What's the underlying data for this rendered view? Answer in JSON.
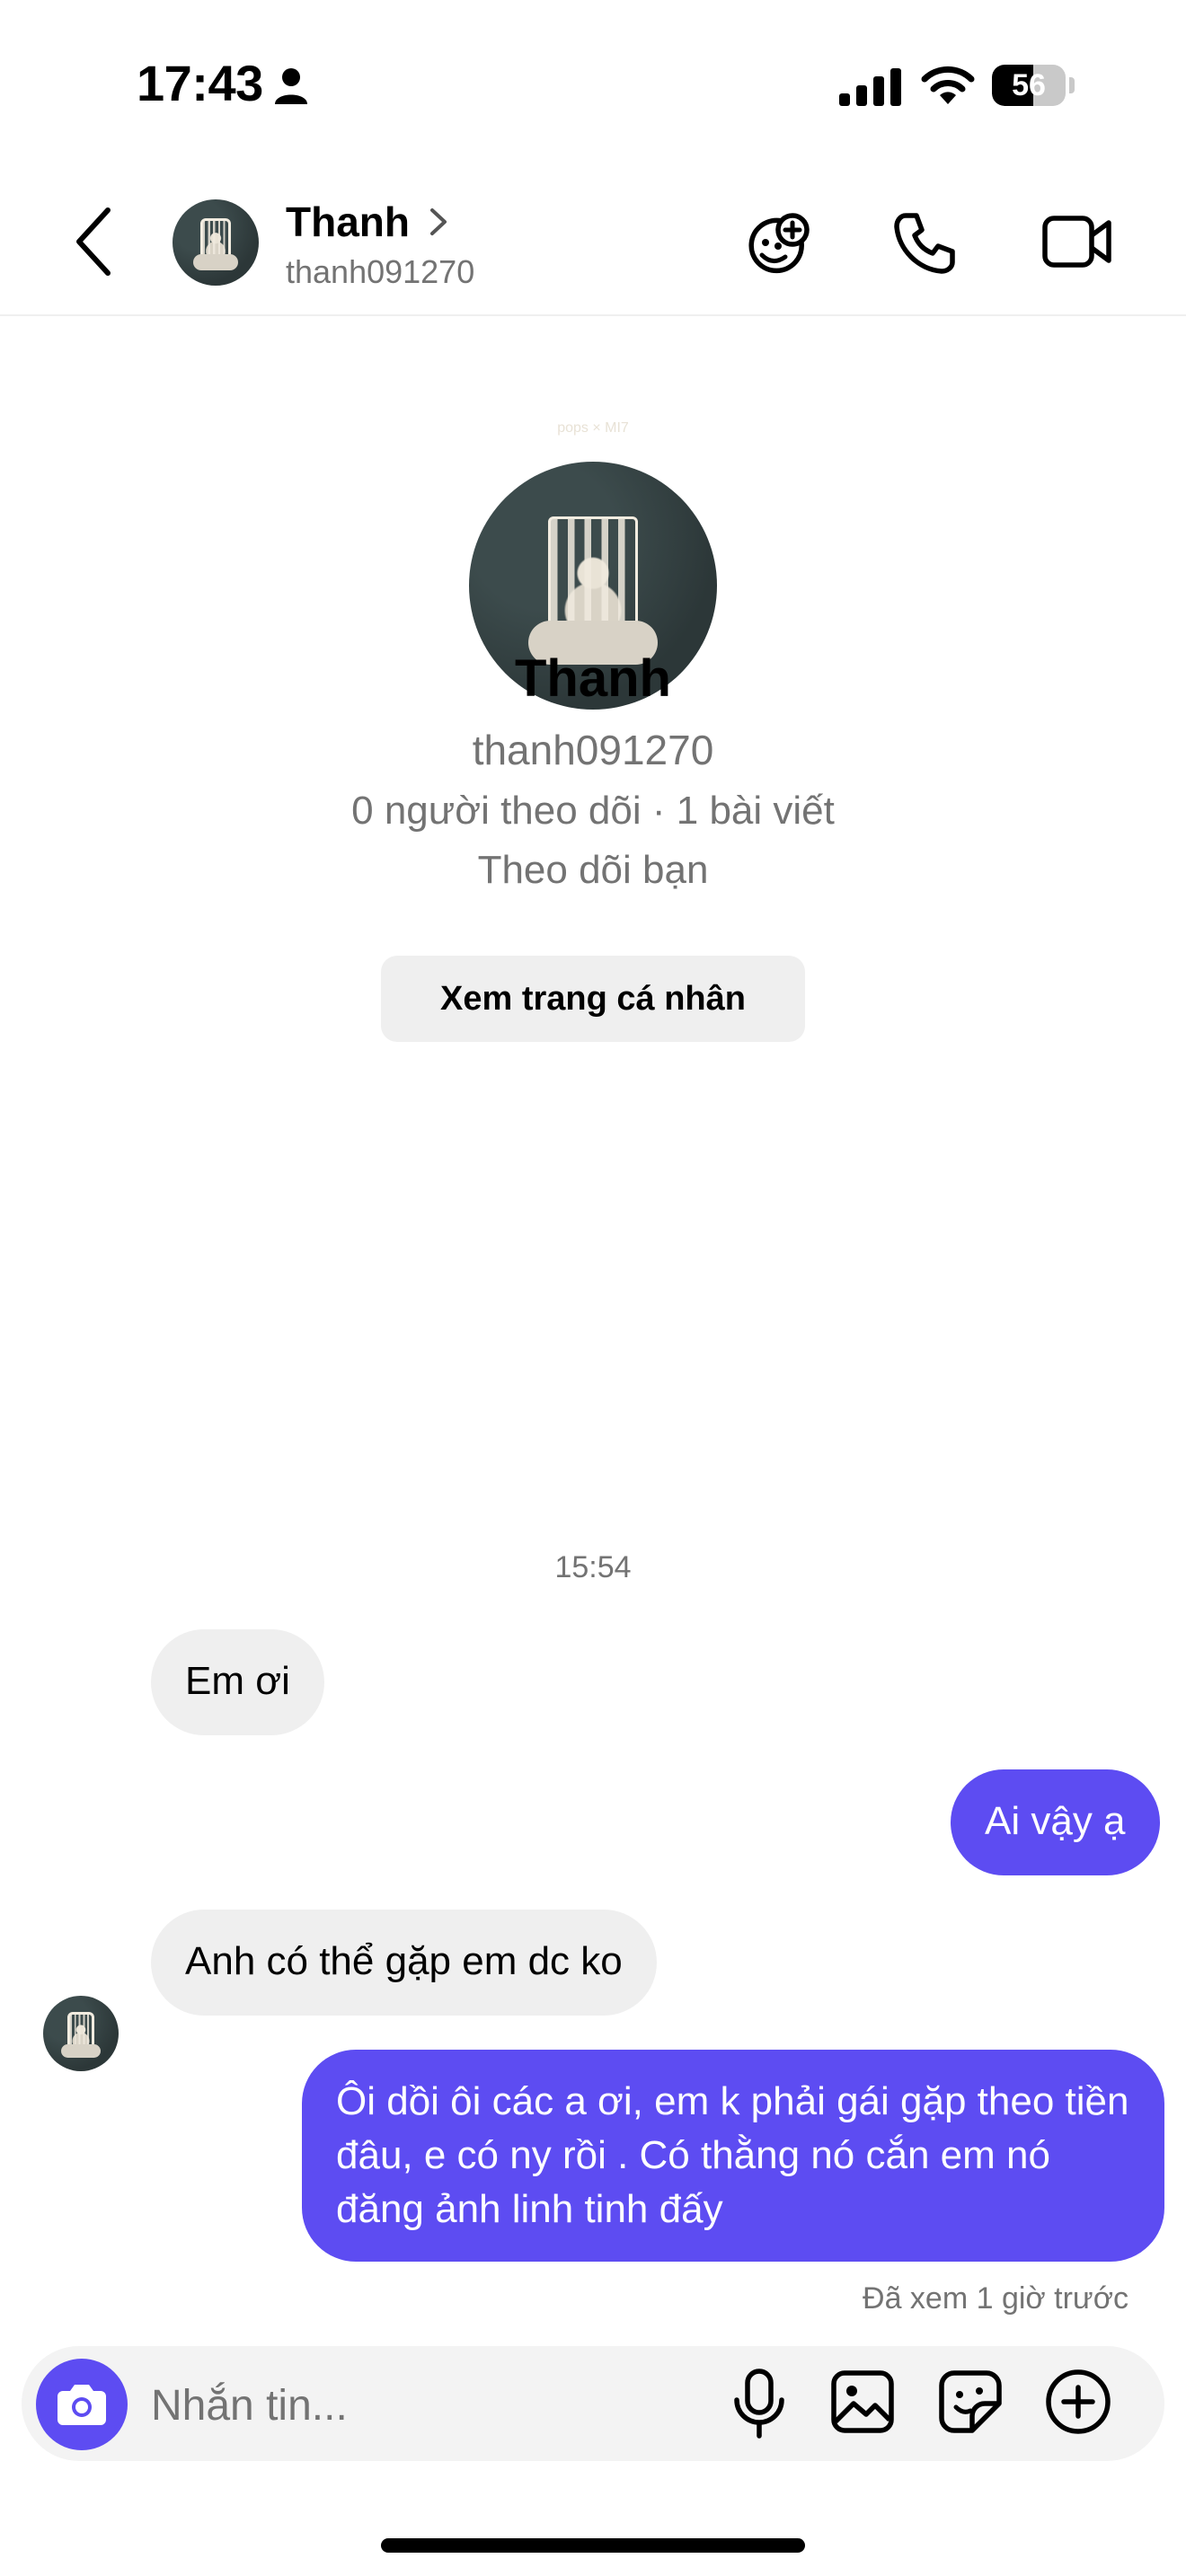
{
  "status_bar": {
    "time": "17:43",
    "battery_level": "56",
    "battery_fraction": 0.56,
    "icons": [
      "person-icon",
      "signal-icon",
      "wifi-icon",
      "battery-icon"
    ]
  },
  "header": {
    "name": "Thanh",
    "username": "thanh091270",
    "icons": [
      "back-icon",
      "chevron-right-icon",
      "sticker-effects-icon",
      "phone-icon",
      "video-camera-icon"
    ]
  },
  "profile": {
    "name": "Thanh",
    "username": "thanh091270",
    "stats": "0 người theo dõi · 1 bài viết",
    "follows_you": "Theo dõi bạn",
    "view_profile_label": "Xem trang cá nhân",
    "avatar_brand": "pops × MI7"
  },
  "messages": {
    "timestamp": "15:54",
    "items": [
      {
        "from": "them",
        "text": "Em ơi"
      },
      {
        "from": "me",
        "text": "Ai vậy ạ"
      },
      {
        "from": "them",
        "text": "Anh có thể gặp em dc ko"
      },
      {
        "from": "me",
        "text": "Ôi dồi ôi các a ơi, em k phải gái gặp theo tiền đâu, e có ny rồi . Có thằng nó cắn em nó đăng ảnh linh tinh đấy"
      }
    ],
    "seen_status": "Đã xem 1 giờ trước"
  },
  "composer": {
    "placeholder": "Nhắn tin...",
    "icons": [
      "camera-icon",
      "microphone-icon",
      "image-icon",
      "sticker-icon",
      "plus-circle-icon"
    ]
  },
  "colors": {
    "accent": "#5d4cf2",
    "incoming_bubble": "#efefef",
    "secondary_text": "#737373"
  }
}
